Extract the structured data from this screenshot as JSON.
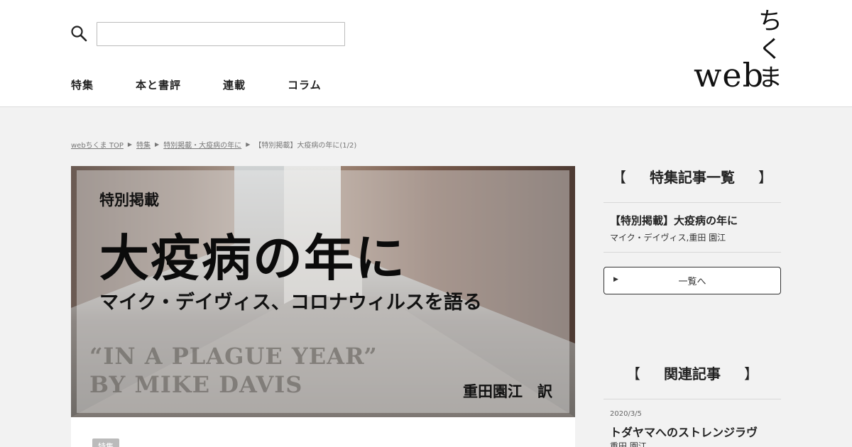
{
  "header": {
    "search": {
      "value": "",
      "placeholder": ""
    },
    "nav": [
      "特集",
      "本と書評",
      "連載",
      "コラム"
    ],
    "logo": {
      "latin": "web",
      "kana": [
        "ち",
        "く",
        "ま"
      ]
    }
  },
  "breadcrumb": {
    "items": [
      "webちくま TOP",
      "特集",
      "特別掲載・大疫病の年に"
    ],
    "current": "【特別掲載】大疫病の年に(1/2)"
  },
  "hero": {
    "kicker": "特別掲載",
    "title": "大疫病の年に",
    "subtitle": "マイク・デイヴィス、コロナウィルスを語る",
    "english": "“IN A PLAGUE YEAR”\nBY MIKE DAVIS",
    "translator": "重田園江　訳"
  },
  "article": {
    "tag": "特集"
  },
  "sidebar": {
    "feature": {
      "heading": "特集記事一覧",
      "bracket_open": "【",
      "bracket_close": "】",
      "item_title": "【特別掲載】大疫病の年に",
      "item_author": "マイク・デイヴィス,重田 園江",
      "button_label": "一覧へ"
    },
    "related": {
      "heading": "関連記事",
      "bracket_open": "【",
      "bracket_close": "】",
      "item_date": "2020/3/5",
      "item_title": "トダヤマへのストレンジラヴ",
      "item_author": "重田 園江"
    }
  }
}
